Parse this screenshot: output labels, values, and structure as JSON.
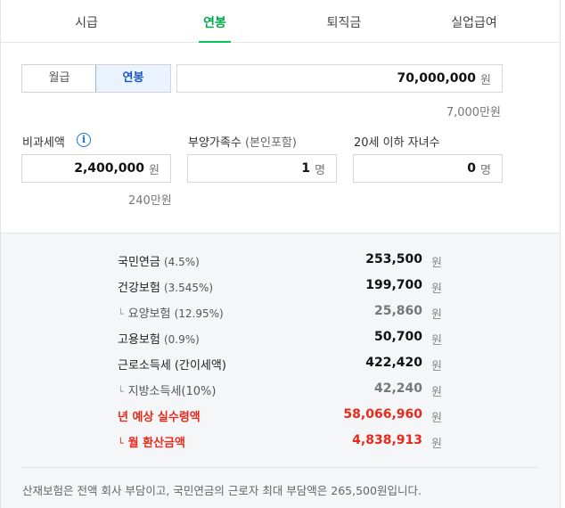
{
  "tabs": [
    "시급",
    "연봉",
    "퇴직금",
    "실업급여"
  ],
  "active_tab": 1,
  "pay_type": {
    "options": [
      "월급",
      "연봉"
    ],
    "selected": 1
  },
  "salary": {
    "value": "70,000,000",
    "unit": "원",
    "hint": "7,000만원"
  },
  "nontaxable": {
    "label": "비과세액",
    "value": "2,400,000",
    "unit": "원",
    "hint": "240만원"
  },
  "dependents": {
    "label": "부양가족수",
    "label_sub": "(본인포함)",
    "value": "1",
    "unit": "명"
  },
  "children": {
    "label": "20세 이하 자녀수",
    "value": "0",
    "unit": "명"
  },
  "results": [
    {
      "label": "국민연금",
      "rate": "(4.5%)",
      "value": "253,500",
      "unit": "원",
      "style": "main"
    },
    {
      "label": "건강보험",
      "rate": "(3.545%)",
      "value": "199,700",
      "unit": "원",
      "style": "main"
    },
    {
      "label": "요양보험",
      "rate": "(12.95%)",
      "value": "25,860",
      "unit": "원",
      "style": "sub"
    },
    {
      "label": "고용보험",
      "rate": "(0.9%)",
      "value": "50,700",
      "unit": "원",
      "style": "main"
    },
    {
      "label": "근로소득세 (간이세액)",
      "rate": "",
      "value": "422,420",
      "unit": "원",
      "style": "main"
    },
    {
      "label": "지방소득세(10%)",
      "rate": "",
      "value": "42,240",
      "unit": "원",
      "style": "sub"
    },
    {
      "label": "년 예상 실수령액",
      "rate": "",
      "value": "58,066,960",
      "unit": "원",
      "style": "red"
    },
    {
      "label": "월 환산금액",
      "rate": "",
      "value": "4,838,913",
      "unit": "원",
      "style": "red-sub"
    }
  ],
  "note": "산재보험은 전액 회사 부담이고, 국민연금의 근로자 최대 부담액은 265,500원입니다.",
  "colors": {
    "accent_green": "#03c75a",
    "active_blue": "#1a56c5",
    "result_red": "#e8291c",
    "info_blue": "#1e6fe0"
  },
  "icons": {
    "info": "info-icon",
    "corner": "corner-arrow-icon"
  }
}
